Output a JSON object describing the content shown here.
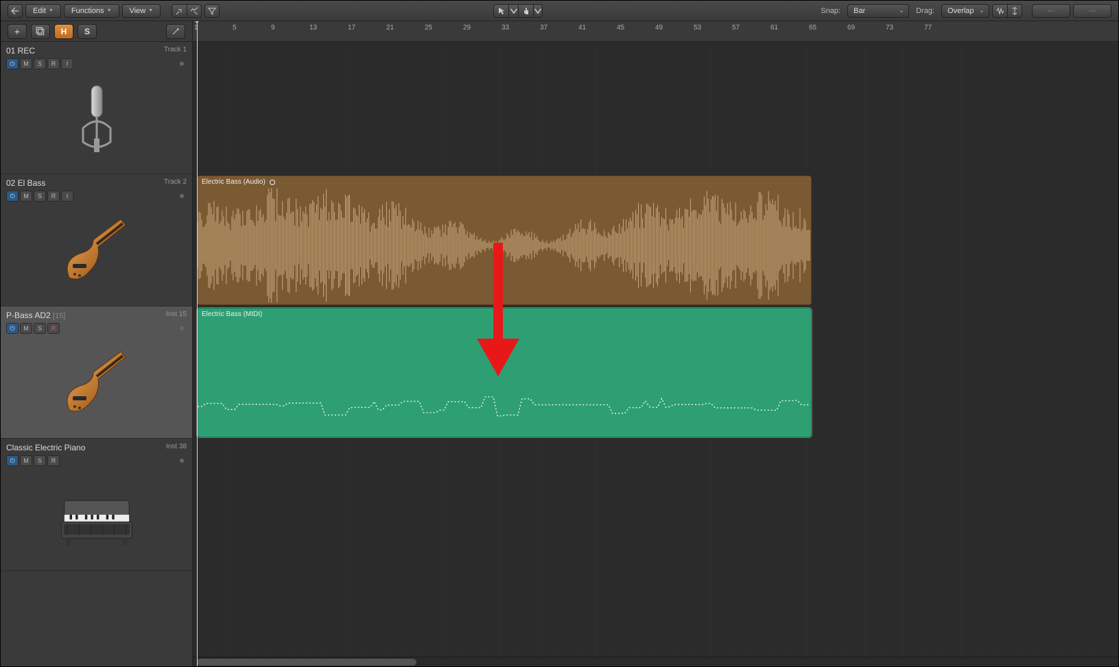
{
  "toolbar": {
    "edit": "Edit",
    "functions": "Functions",
    "view": "View",
    "snap_label": "Snap:",
    "snap_value": "Bar",
    "drag_label": "Drag:",
    "drag_value": "Overlap"
  },
  "subbar": {
    "hide_btn": "H",
    "solo_btn": "S"
  },
  "ruler_ticks": [
    "1",
    "5",
    "9",
    "13",
    "17",
    "21",
    "25",
    "29",
    "33",
    "37",
    "41",
    "45",
    "49",
    "53",
    "57",
    "61",
    "65",
    "69",
    "73",
    "77"
  ],
  "tracks": [
    {
      "name": "01 REC",
      "number": "Track 1",
      "buttons": [
        "M",
        "S",
        "R",
        "I"
      ],
      "power": true,
      "instrument": "mic"
    },
    {
      "name": "02 El Bass",
      "number": "Track 2",
      "buttons": [
        "M",
        "S",
        "R",
        "I"
      ],
      "power": true,
      "instrument": "bass",
      "region": {
        "label": "Electric Bass (Audio)",
        "type": "audio"
      }
    },
    {
      "name": "P-Bass AD2",
      "extra": "[15]",
      "number": "Inst 15",
      "buttons": [
        "M",
        "S",
        "R"
      ],
      "power": true,
      "rec": true,
      "selected": true,
      "instrument": "bass",
      "region": {
        "label": "Electric Bass (MIDI)",
        "type": "midi",
        "selected": true
      }
    },
    {
      "name": "Classic Electric Piano",
      "number": "Inst 38",
      "buttons": [
        "M",
        "S",
        "R"
      ],
      "power": true,
      "instrument": "epiano"
    }
  ]
}
